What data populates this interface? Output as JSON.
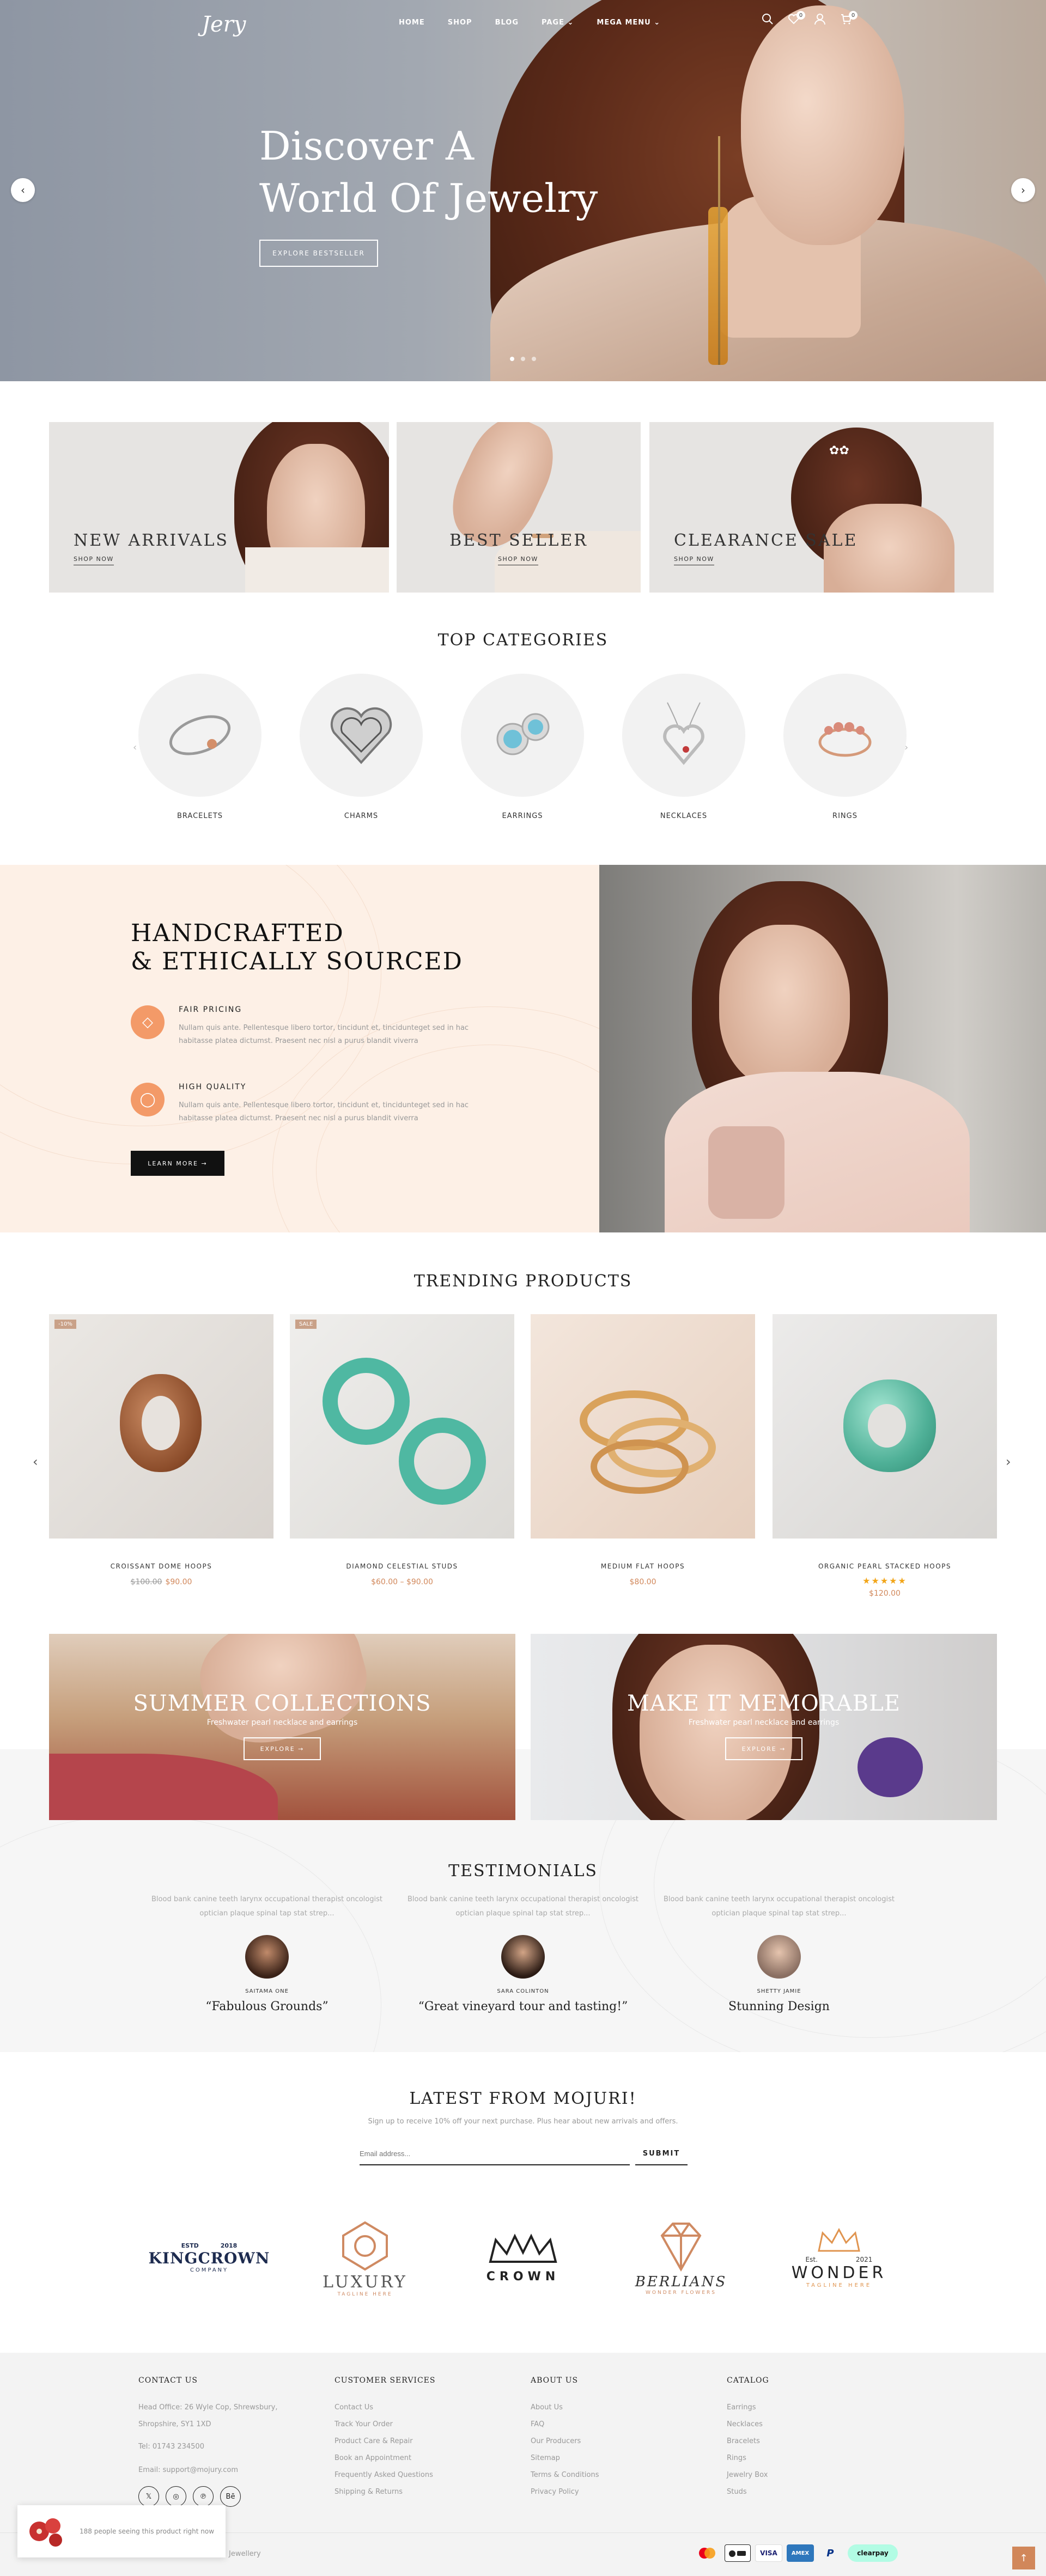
{
  "header": {
    "logo": "Jery",
    "nav": [
      "HOME",
      "SHOP",
      "BLOG",
      "PAGE ⌄",
      "MEGA MENU ⌄"
    ],
    "wishlist_count": "0",
    "cart_count": "0"
  },
  "hero": {
    "title_line1": "Discover A",
    "title_line2": "World Of Jewelry",
    "button": "EXPLORE BESTSELLER",
    "active_slide": 1,
    "slide_count": 3
  },
  "banners": [
    {
      "title": "NEW ARRIVALS",
      "link": "SHOP NOW"
    },
    {
      "title": "BEST SELLER",
      "link": "SHOP NOW"
    },
    {
      "title": "CLEARANCE SALE",
      "link": "SHOP NOW"
    }
  ],
  "categories": {
    "title": "TOP CATEGORIES",
    "items": [
      "BRACELETS",
      "CHARMS",
      "EARRINGS",
      "NECKLACES",
      "RINGS"
    ]
  },
  "handcrafted": {
    "title_line1": "HANDCRAFTED",
    "title_line2": "& ETHICALLY SOURCED",
    "features": [
      {
        "title": "FAIR PRICING",
        "desc": "Nullam quis ante. Pellentesque libero tortor, tincidunt et, tincidunteget sed in hac habitasse platea dictumst. Praesent nec nisl a purus blandit viverra"
      },
      {
        "title": "HIGH QUALITY",
        "desc": "Nullam quis ante. Pellentesque libero tortor, tincidunt et, tincidunteget sed in hac habitasse platea dictumst. Praesent nec nisl a purus blandit viverra"
      }
    ],
    "button": "LEARN MORE →"
  },
  "trending": {
    "title": "TRENDING PRODUCTS",
    "products": [
      {
        "name": "CROISSANT DOME HOOPS",
        "old_price": "$100.00",
        "price": "$90.00",
        "tag": "-10%"
      },
      {
        "name": "DIAMOND CELESTIAL STUDS",
        "price": "$60.00 – $90.00",
        "tag": "SALE"
      },
      {
        "name": "MEDIUM FLAT HOOPS",
        "price": "$80.00"
      },
      {
        "name": "ORGANIC PEARL STACKED HOOPS",
        "price": "$120.00",
        "rating": 5
      }
    ]
  },
  "collections": [
    {
      "title": "SUMMER COLLECTIONS",
      "subtitle": "Freshwater pearl necklace and earrings",
      "button": "EXPLORE →"
    },
    {
      "title": "MAKE IT MEMORABLE",
      "subtitle": "Freshwater pearl necklace and earrings",
      "button": "EXPLORE →"
    }
  ],
  "testimonials": {
    "title": "TESTIMONIALS",
    "items": [
      {
        "quote": "Blood bank canine teeth larynx occupational therapist oncologist optician plaque spinal tap stat strep...",
        "name": "SAITAMA ONE",
        "title": "“Fabulous Grounds”"
      },
      {
        "quote": "Blood bank canine teeth larynx occupational therapist oncologist optician plaque spinal tap stat strep...",
        "name": "SARA COLINTON",
        "title": "“Great vineyard tour and tasting!”"
      },
      {
        "quote": "Blood bank canine teeth larynx occupational therapist oncologist optician plaque spinal tap stat strep...",
        "name": "SHETTY JAMIE",
        "title": "Stunning Design"
      }
    ]
  },
  "newsletter": {
    "title": "LATEST FROM MOJURI!",
    "subtitle": "Sign up to receive 10% off your next purchase. Plus hear about new arrivals and offers.",
    "placeholder": "Email address...",
    "button": "SUBMIT"
  },
  "brands": {
    "kingcrown": {
      "est": "ESTD",
      "year": "2018",
      "name": "KINGCROWN",
      "sub": "COMPANY"
    },
    "luxury": {
      "name": "LUXURY",
      "sub": "TAGLINE HERE"
    },
    "crown": {
      "name": "CROWN"
    },
    "berlians": {
      "name": "BERLIANS",
      "sub": "WONDER FLOWERS"
    },
    "wonder": {
      "est": "Est.",
      "year": "2021",
      "name": "WONDER",
      "sub": "TAGLINE HERE"
    }
  },
  "footer": {
    "contact": {
      "title": "CONTACT US",
      "address": "Head Office: 26 Wyle Cop, Shrewsbury, Shropshire, SY1 1XD",
      "phone": "Tel: 01743 234500",
      "email": "Email: support@mojury.com"
    },
    "social": [
      "𝕏",
      "◎",
      "℗",
      "Bē"
    ],
    "customer_services": {
      "title": "CUSTOMER SERVICES",
      "links": [
        "Contact Us",
        "Track Your Order",
        "Product Care & Repair",
        "Book an Appointment",
        "Frequently Asked Questions",
        "Shipping & Returns"
      ]
    },
    "about": {
      "title": "ABOUT US",
      "links": [
        "About Us",
        "FAQ",
        "Our Producers",
        "Sitemap",
        "Terms & Conditions",
        "Privacy Policy"
      ]
    },
    "catalog": {
      "title": "CATALOG",
      "links": [
        "Earrings",
        "Necklaces",
        "Bracelets",
        "Rings",
        "Jewelry Box",
        "Studs"
      ]
    },
    "copyright": "Jewellery",
    "payments": [
      "VISA",
      "AMEX",
      "P",
      "clearpay"
    ]
  },
  "toast": {
    "text": "188 people seeing this product right now"
  },
  "colors": {
    "accent": "#d1875a",
    "peach_bg": "#fdf0e6",
    "icon_peach": "#f39a68"
  }
}
